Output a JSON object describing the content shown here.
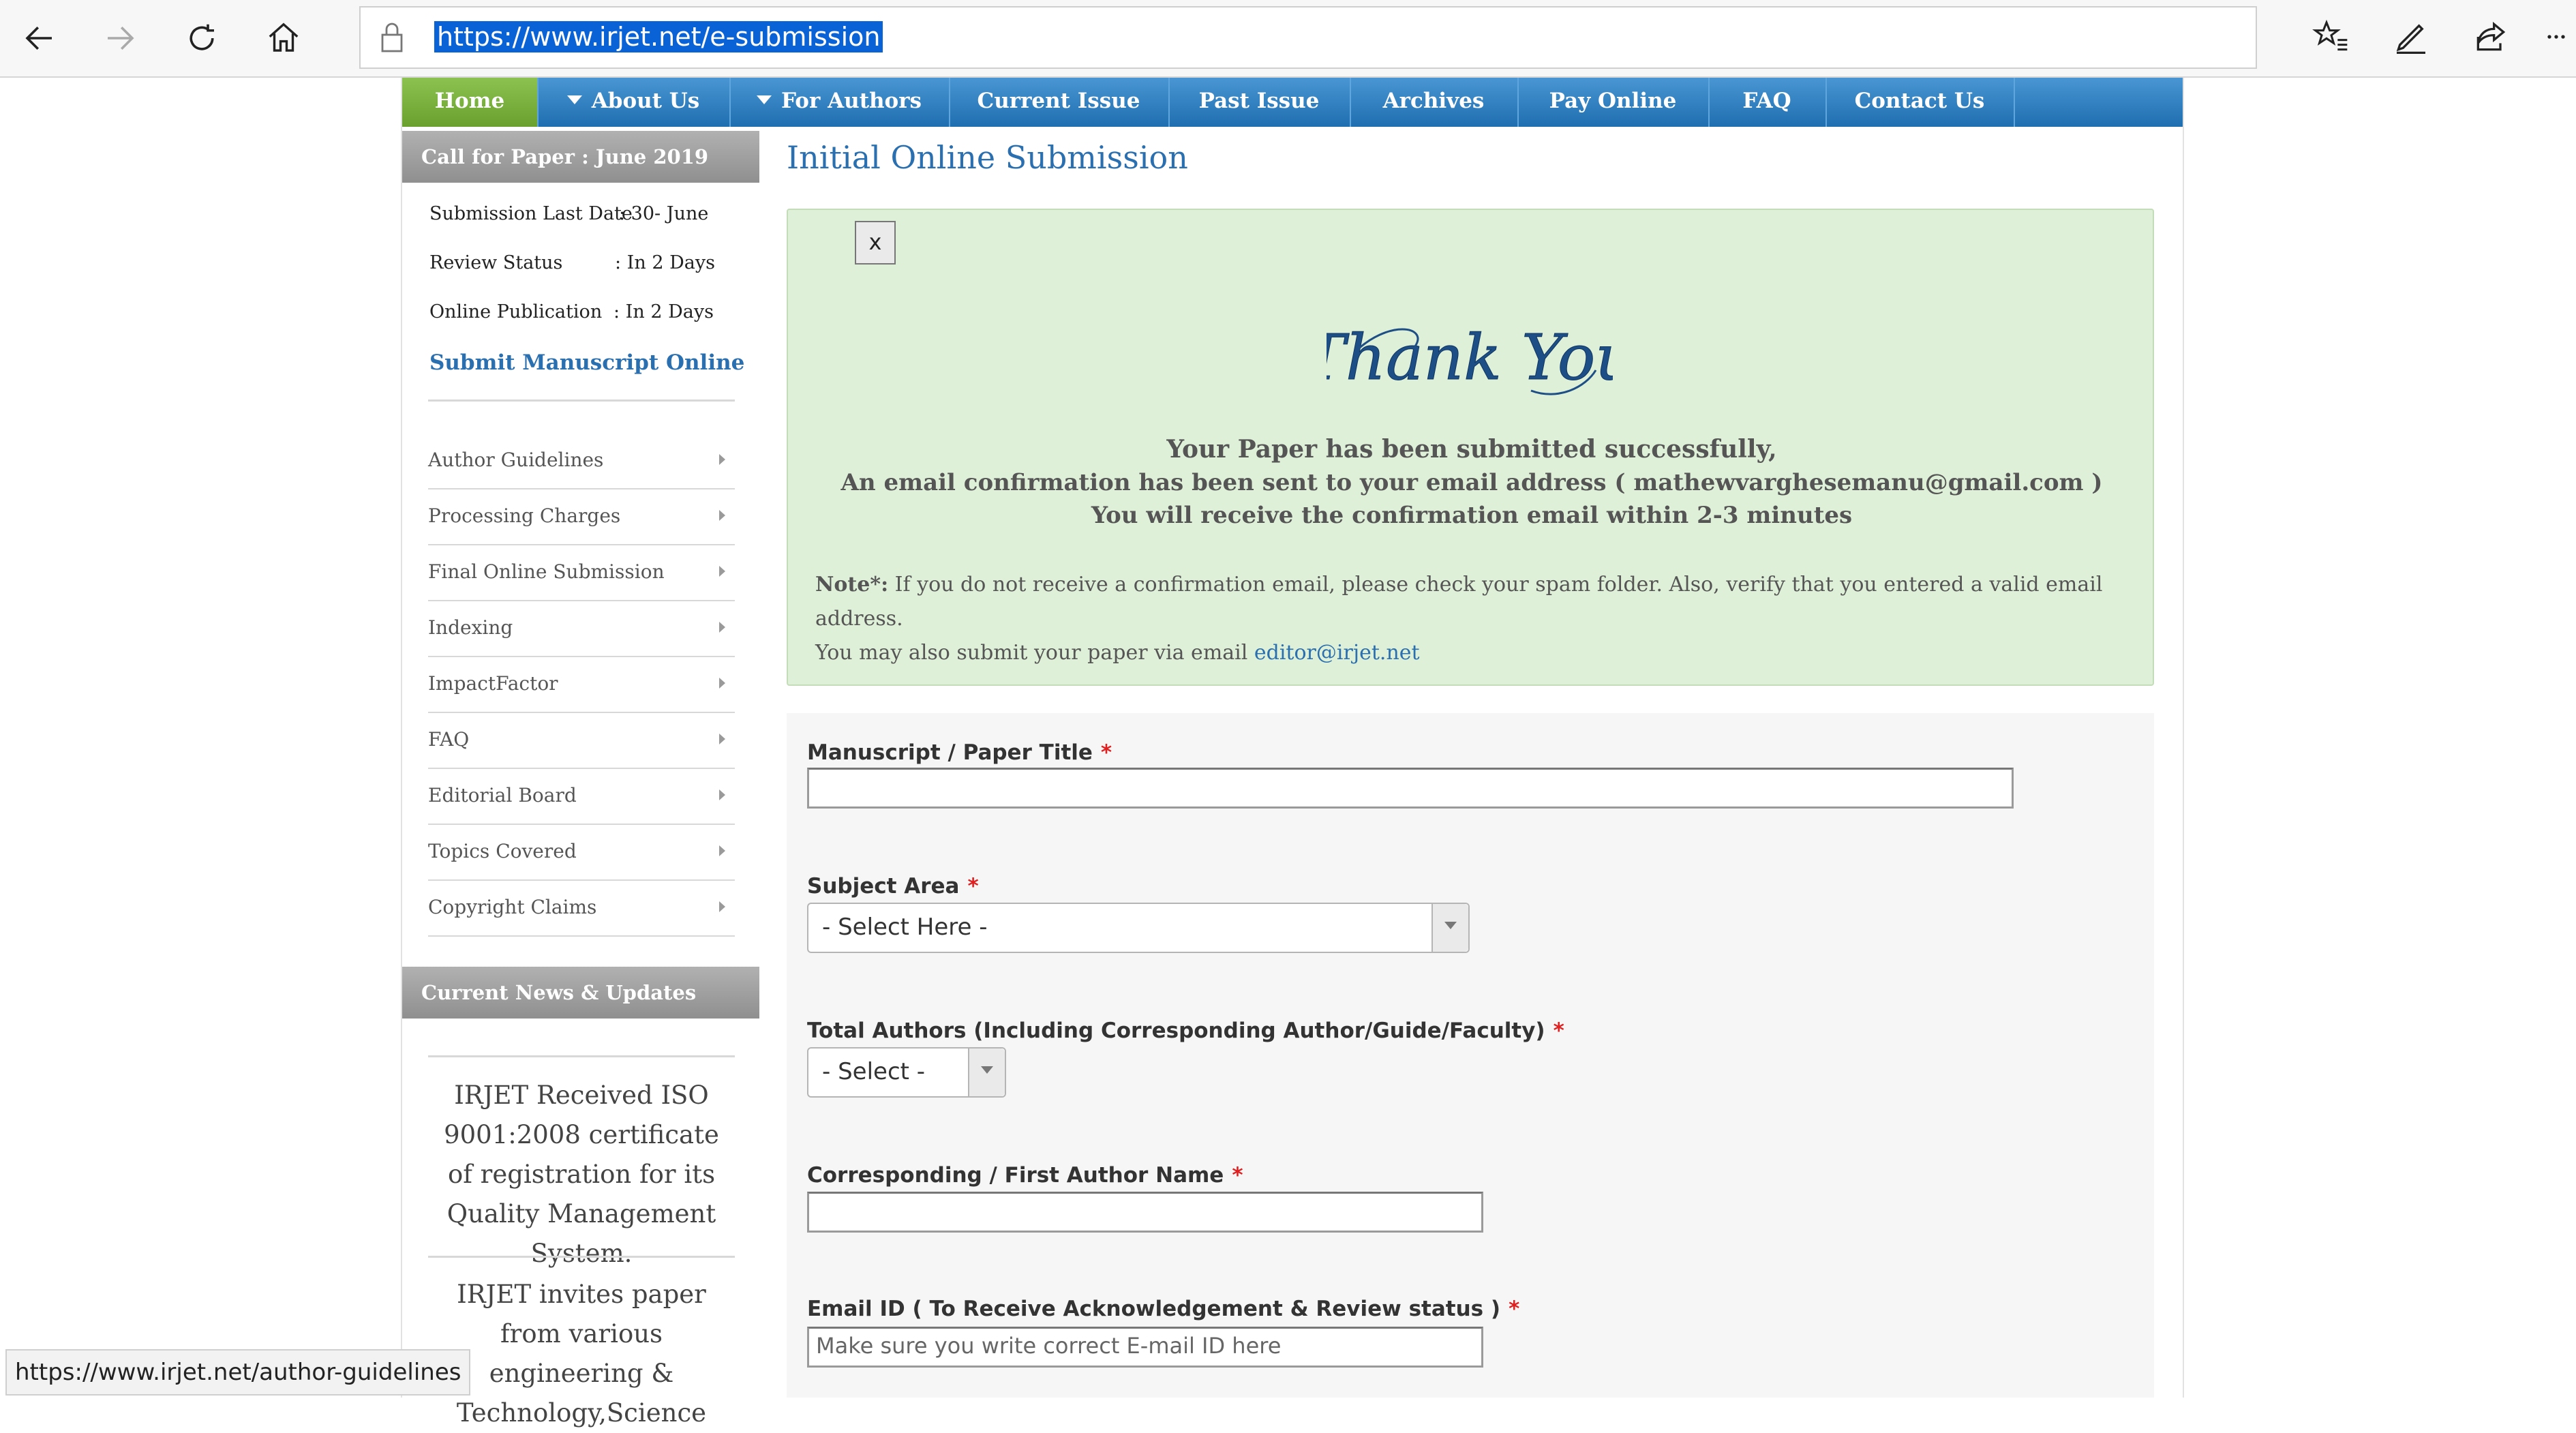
{
  "browser": {
    "url": "https://www.irjet.net/e-submission",
    "status_url": "https://www.irjet.net/author-guidelines"
  },
  "menu": {
    "items": [
      {
        "label": "Home"
      },
      {
        "label": "About Us"
      },
      {
        "label": "For Authors"
      },
      {
        "label": "Current Issue"
      },
      {
        "label": "Past Issue"
      },
      {
        "label": "Archives"
      },
      {
        "label": "Pay Online"
      },
      {
        "label": "FAQ"
      },
      {
        "label": "Contact Us"
      }
    ],
    "active_color": "#6aa12e",
    "bar_color": "#2a7bc0"
  },
  "sidebar": {
    "call_heading": "Call for Paper : June 2019",
    "info": [
      {
        "label": "Submission Last Date",
        "value": ": 30- June"
      },
      {
        "label": "Review Status",
        "value": ": In 2 Days"
      },
      {
        "label": "Online Publication",
        "value": ": In 2 Days"
      }
    ],
    "submit_link": "Submit Manuscript Online",
    "links": [
      {
        "label": "Author Guidelines"
      },
      {
        "label": "Processing Charges"
      },
      {
        "label": "Final Online Submission"
      },
      {
        "label": "Indexing"
      },
      {
        "label": "ImpactFactor"
      },
      {
        "label": "FAQ"
      },
      {
        "label": "Editorial Board"
      },
      {
        "label": "Topics Covered"
      },
      {
        "label": "Copyright Claims"
      }
    ],
    "news_heading": "Current News & Updates",
    "news": [
      "IRJET Received ISO 9001:2008 certificate of registration for its Quality Management System.",
      "IRJET invites paper from various engineering & Technology,Science"
    ]
  },
  "main": {
    "title": "Initial Online Submission",
    "alert": {
      "close_label": "x",
      "thank_you": "Thank You",
      "line1": "Your Paper has been submitted successfully,",
      "line2": "An email confirmation has been sent to your email address ( mathewvarghesemanu@gmail.com )",
      "line3": "You will receive the confirmation email within 2-3 minutes",
      "note_label": "Note*:",
      "note_text": " If you do not receive a confirmation email, please check your spam folder. Also, verify that you entered a valid email address.",
      "note_line2": "You may also submit your paper via email ",
      "note_email": "editor@irjet.net",
      "bg_color": "#dff0d8"
    },
    "form": {
      "title_label": "Manuscript / Paper Title",
      "title_value": "",
      "subject_label": "Subject Area",
      "subject_value": "- Select Here -",
      "authors_label": "Total Authors (Including Corresponding Author/Guide/Faculty)",
      "authors_value": "- Select -",
      "author_name_label": "Corresponding / First Author Name",
      "author_name_value": "",
      "email_label": "Email ID ( To Receive Acknowledgement & Review status )",
      "email_placeholder": "Make sure you write correct E-mail ID here",
      "required_mark": "*"
    }
  }
}
